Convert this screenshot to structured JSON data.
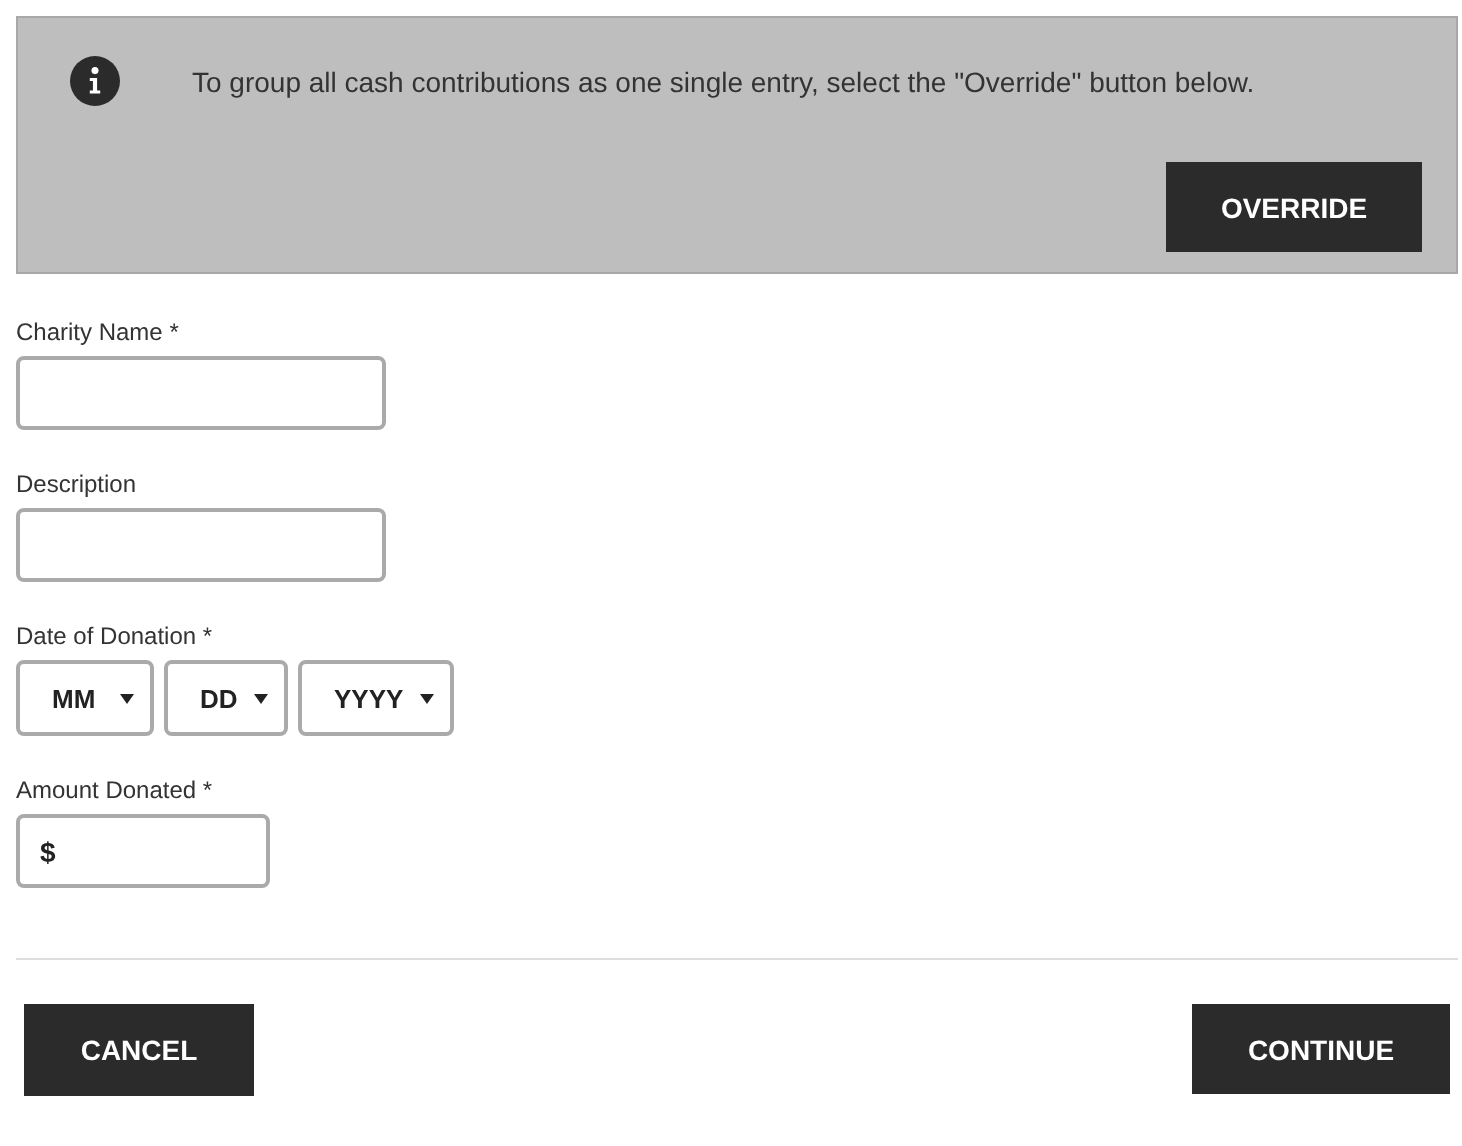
{
  "notice": {
    "message": "To group all cash contributions as one single entry, select the \"Override\" button below.",
    "button": "OVERRIDE"
  },
  "fields": [
    {
      "kind": "text",
      "label": "Charity Name *"
    },
    {
      "kind": "text",
      "label": "Description"
    },
    {
      "kind": "date",
      "label": "Date of Donation *",
      "selects": [
        "MM",
        "DD",
        "YYYY"
      ]
    },
    {
      "kind": "amount",
      "label": "Amount Donated *",
      "value": "$"
    }
  ],
  "buttons": [
    {
      "label": "CANCEL"
    },
    {
      "label": "CONTINUE"
    }
  ]
}
